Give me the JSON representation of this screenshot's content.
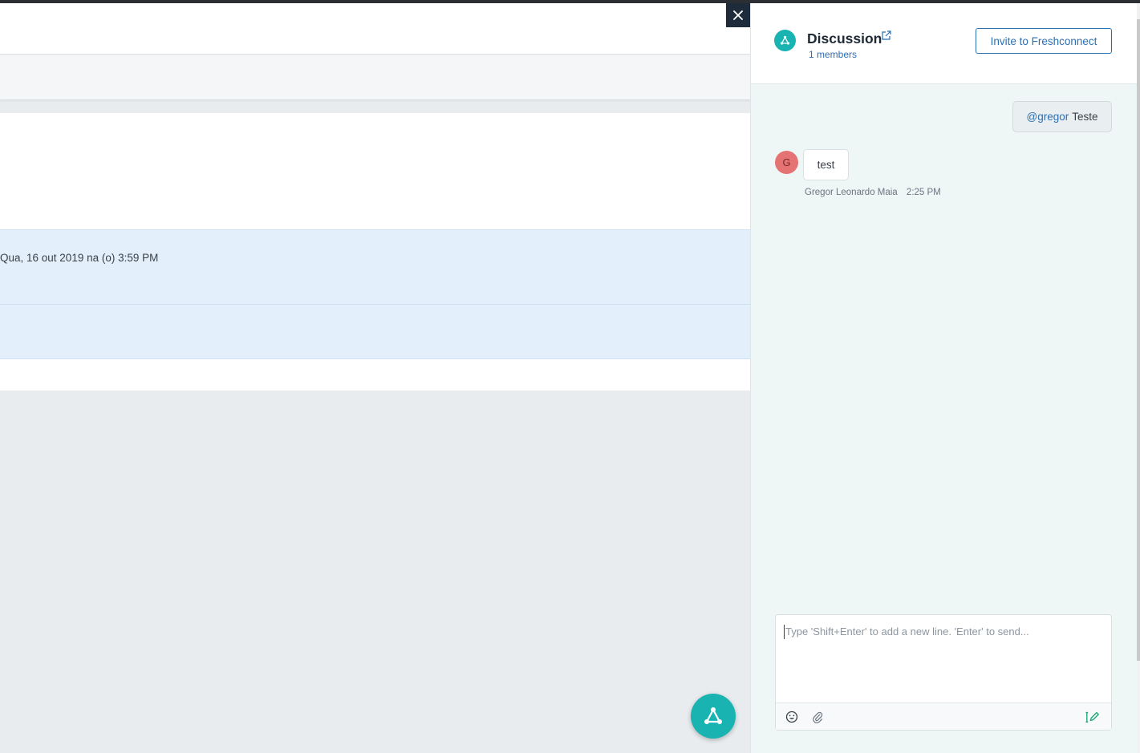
{
  "background_app": {
    "row_text": "Qua, 16 out 2019 na (o) 3:59 PM"
  },
  "close_icon": "close-icon",
  "discussion": {
    "title": "Discussion",
    "members": "1 members",
    "invite_label": "Invite to Freshconnect",
    "messages": [
      {
        "direction": "outgoing",
        "mention": "@gregor",
        "text": "Teste"
      },
      {
        "direction": "incoming",
        "avatar_initial": "G",
        "text": "test",
        "author": "Gregor Leonardo Maia",
        "time": "2:25 PM"
      }
    ],
    "composer": {
      "placeholder": "Type 'Shift+Enter' to add a new line. 'Enter' to send..."
    }
  },
  "colors": {
    "accent_teal": "#19b3b1",
    "link_blue": "#2c6fb3",
    "avatar_red": "#e57373"
  }
}
